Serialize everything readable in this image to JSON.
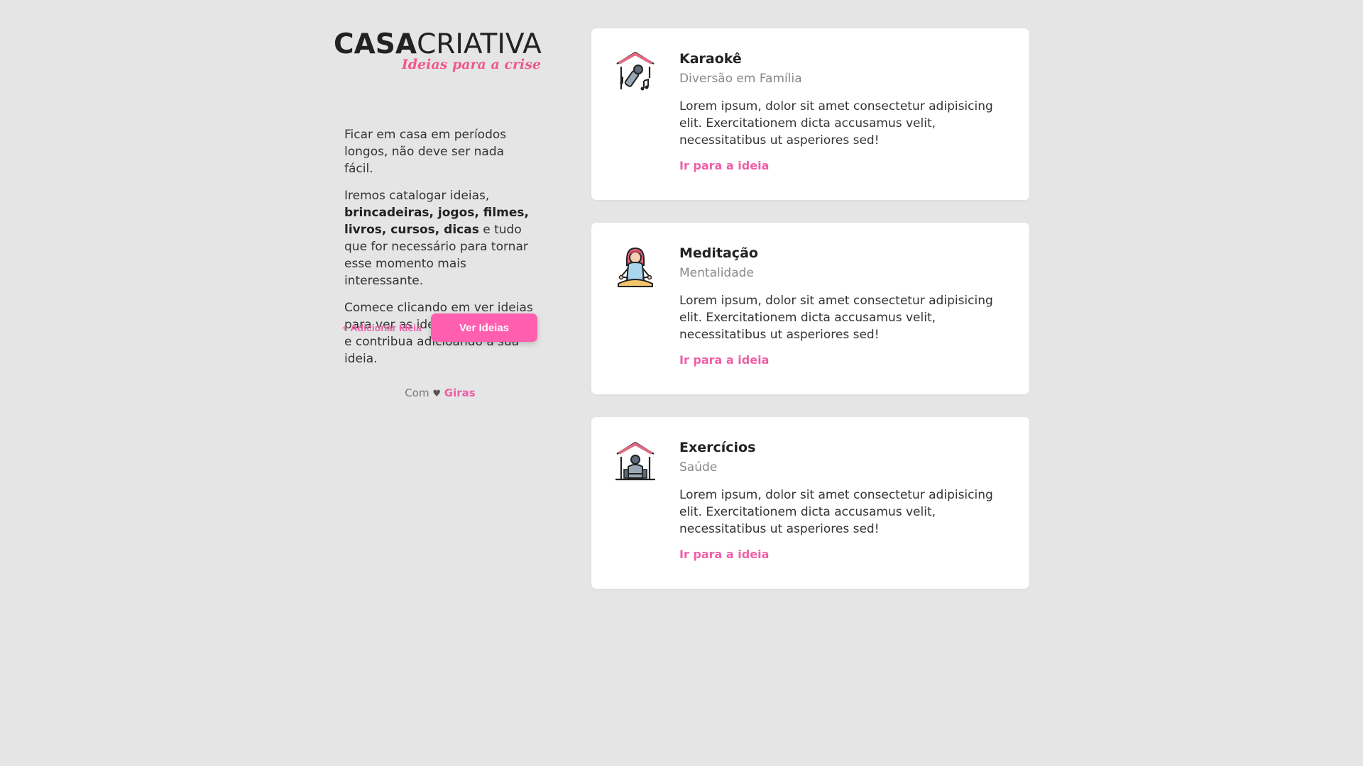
{
  "brand": {
    "name_part1": "CASA",
    "name_part2": "CRIATIVA",
    "tagline": "Ideias para a crise",
    "accent_color": "#ff5fae"
  },
  "intro": {
    "paragraph1": "Ficar em casa em períodos longos, não deve ser nada fácil.",
    "paragraph2_start": "Iremos catalogar ideias, ",
    "paragraph2_bold": "brincadeiras, jogos, filmes, livros, cursos, dicas",
    "paragraph2_end": " e tudo que for necessário para tornar esse momento mais interessante.",
    "paragraph3": "Comece clicando em ver ideias para ver as ideias cadastradas e contribua adicioando a sua ideia."
  },
  "actions": {
    "add_label": "+ Adicionar Ideia",
    "see_label": "Ver Ideias"
  },
  "footer": {
    "prefix": "Com",
    "heart": "♥",
    "author": "Giras"
  },
  "cards": [
    {
      "icon": "karaoke-house-icon",
      "title": "Karaokê",
      "category": "Diversão em Família",
      "text": "Lorem ipsum, dolor sit amet consectetur adipisicing elit. Exercitationem dicta accusamus velit, necessitatibus ut asperiores sed!",
      "link": "Ir para a ideia"
    },
    {
      "icon": "meditation-icon",
      "title": "Meditação",
      "category": "Mentalidade",
      "text": "Lorem ipsum, dolor sit amet consectetur adipisicing elit. Exercitationem dicta accusamus velit, necessitatibus ut asperiores sed!",
      "link": "Ir para a ideia"
    },
    {
      "icon": "exercise-house-icon",
      "title": "Exercícios",
      "category": "Saúde",
      "text": "Lorem ipsum, dolor sit amet consectetur adipisicing elit. Exercitationem dicta accusamus velit, necessitatibus ut asperiores sed!",
      "link": "Ir para a ideia"
    }
  ]
}
